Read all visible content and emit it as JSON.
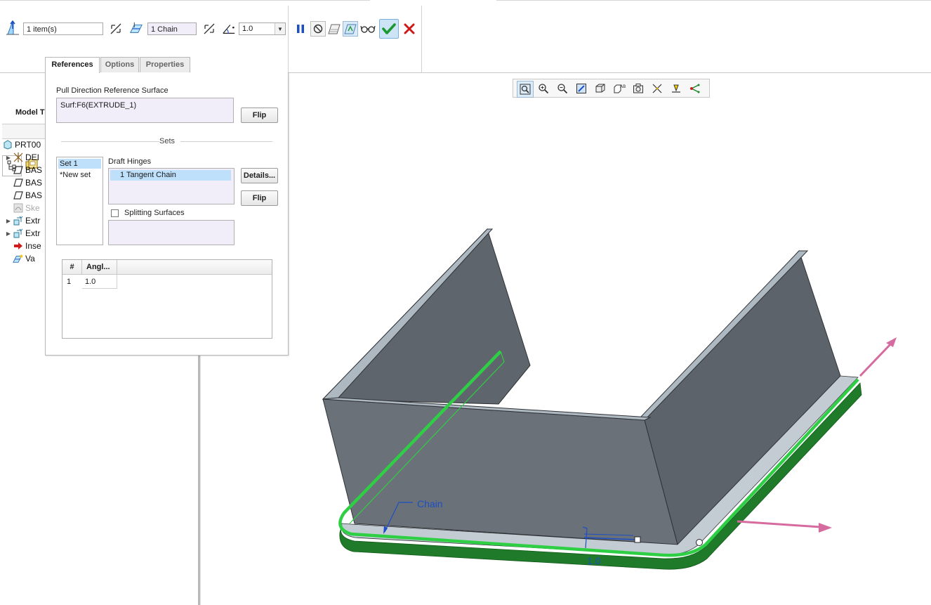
{
  "dashboard": {
    "surfaces_collector": "1 item(s)",
    "hinges_collector": "1 Chain",
    "angle_value": "1.0",
    "tabs": [
      "References",
      "Options",
      "Properties"
    ]
  },
  "references_panel": {
    "pull_direction_label": "Pull Direction Reference Surface",
    "pull_direction_value": "Surf:F6(EXTRUDE_1)",
    "flip_label": "Flip",
    "sets_label": "Sets",
    "sets": [
      "Set 1",
      "*New set"
    ],
    "draft_hinges_label": "Draft Hinges",
    "draft_hinges_item": "1 Tangent Chain",
    "details_label": "Details...",
    "flip2_label": "Flip",
    "splitting_surfaces_label": "Splitting Surfaces",
    "splitting_checked": false,
    "angle_table": {
      "headers": [
        "#",
        "Angl..."
      ],
      "rows": [
        [
          "1",
          "1.0"
        ]
      ]
    }
  },
  "model_tree": {
    "header": "Model T",
    "items": [
      "PRT00",
      "DEI",
      "BAS",
      "BAS",
      "BAS",
      "Ske",
      "Extr",
      "Extr",
      "Inse",
      "Va"
    ]
  },
  "graphics": {
    "chain_label": "Chain",
    "angle_annotation": "1.0"
  },
  "colors": {
    "accent_blue": "#1d4fc4",
    "selection_green": "#2fcf45",
    "draft_green": "#1f7a2a",
    "arrow_pink": "#d66ba0",
    "model_gray": "#636a71",
    "confirm_green": "#1a9a2e",
    "cancel_red": "#cc1a1a"
  }
}
